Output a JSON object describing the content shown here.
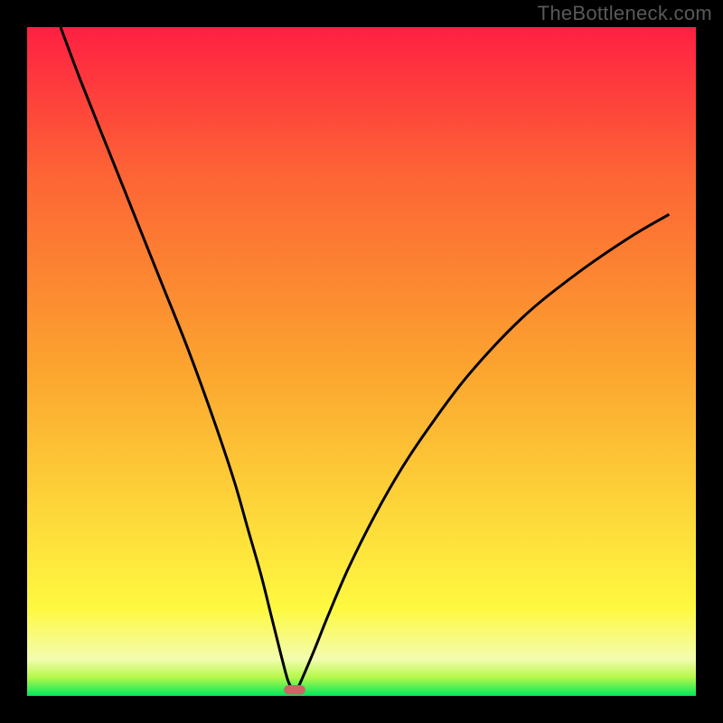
{
  "watermark": "TheBottleneck.com",
  "chart_data": {
    "type": "line",
    "title": "",
    "xlabel": "",
    "ylabel": "",
    "xlim": [
      0,
      100
    ],
    "ylim": [
      0,
      100
    ],
    "grid": false,
    "legend": false,
    "background_gradient_stops": [
      {
        "pos": 0.0,
        "color": "#00e85a"
      },
      {
        "pos": 0.028,
        "color": "#b6f84a"
      },
      {
        "pos": 0.055,
        "color": "#f3fcaf"
      },
      {
        "pos": 0.13,
        "color": "#fef940"
      },
      {
        "pos": 0.5,
        "color": "#fca22f"
      },
      {
        "pos": 0.78,
        "color": "#fd6435"
      },
      {
        "pos": 1.0,
        "color": "#fe2042"
      }
    ],
    "series": [
      {
        "name": "curve",
        "x": [
          5,
          8,
          12,
          16,
          20,
          24,
          28,
          31,
          33,
          35,
          36.5,
          38,
          39,
          39.8,
          40.3,
          41,
          43,
          45,
          48,
          52,
          56,
          60,
          66,
          74,
          82,
          90,
          96
        ],
        "y": [
          100,
          92,
          82,
          72,
          62,
          52,
          41,
          32,
          25,
          18,
          12,
          6,
          2.3,
          0.9,
          0.9,
          2.3,
          7,
          12,
          19,
          27,
          34,
          40,
          48,
          56.5,
          63,
          68.5,
          72
        ]
      }
    ],
    "marker": {
      "x": 40,
      "y": 0.9,
      "width": 3.2,
      "height": 1.4,
      "color": "#c96666"
    },
    "frame_color": "#000000",
    "frame_thickness_px": 30,
    "curve_color": "#000000",
    "curve_thickness_px": 3
  }
}
